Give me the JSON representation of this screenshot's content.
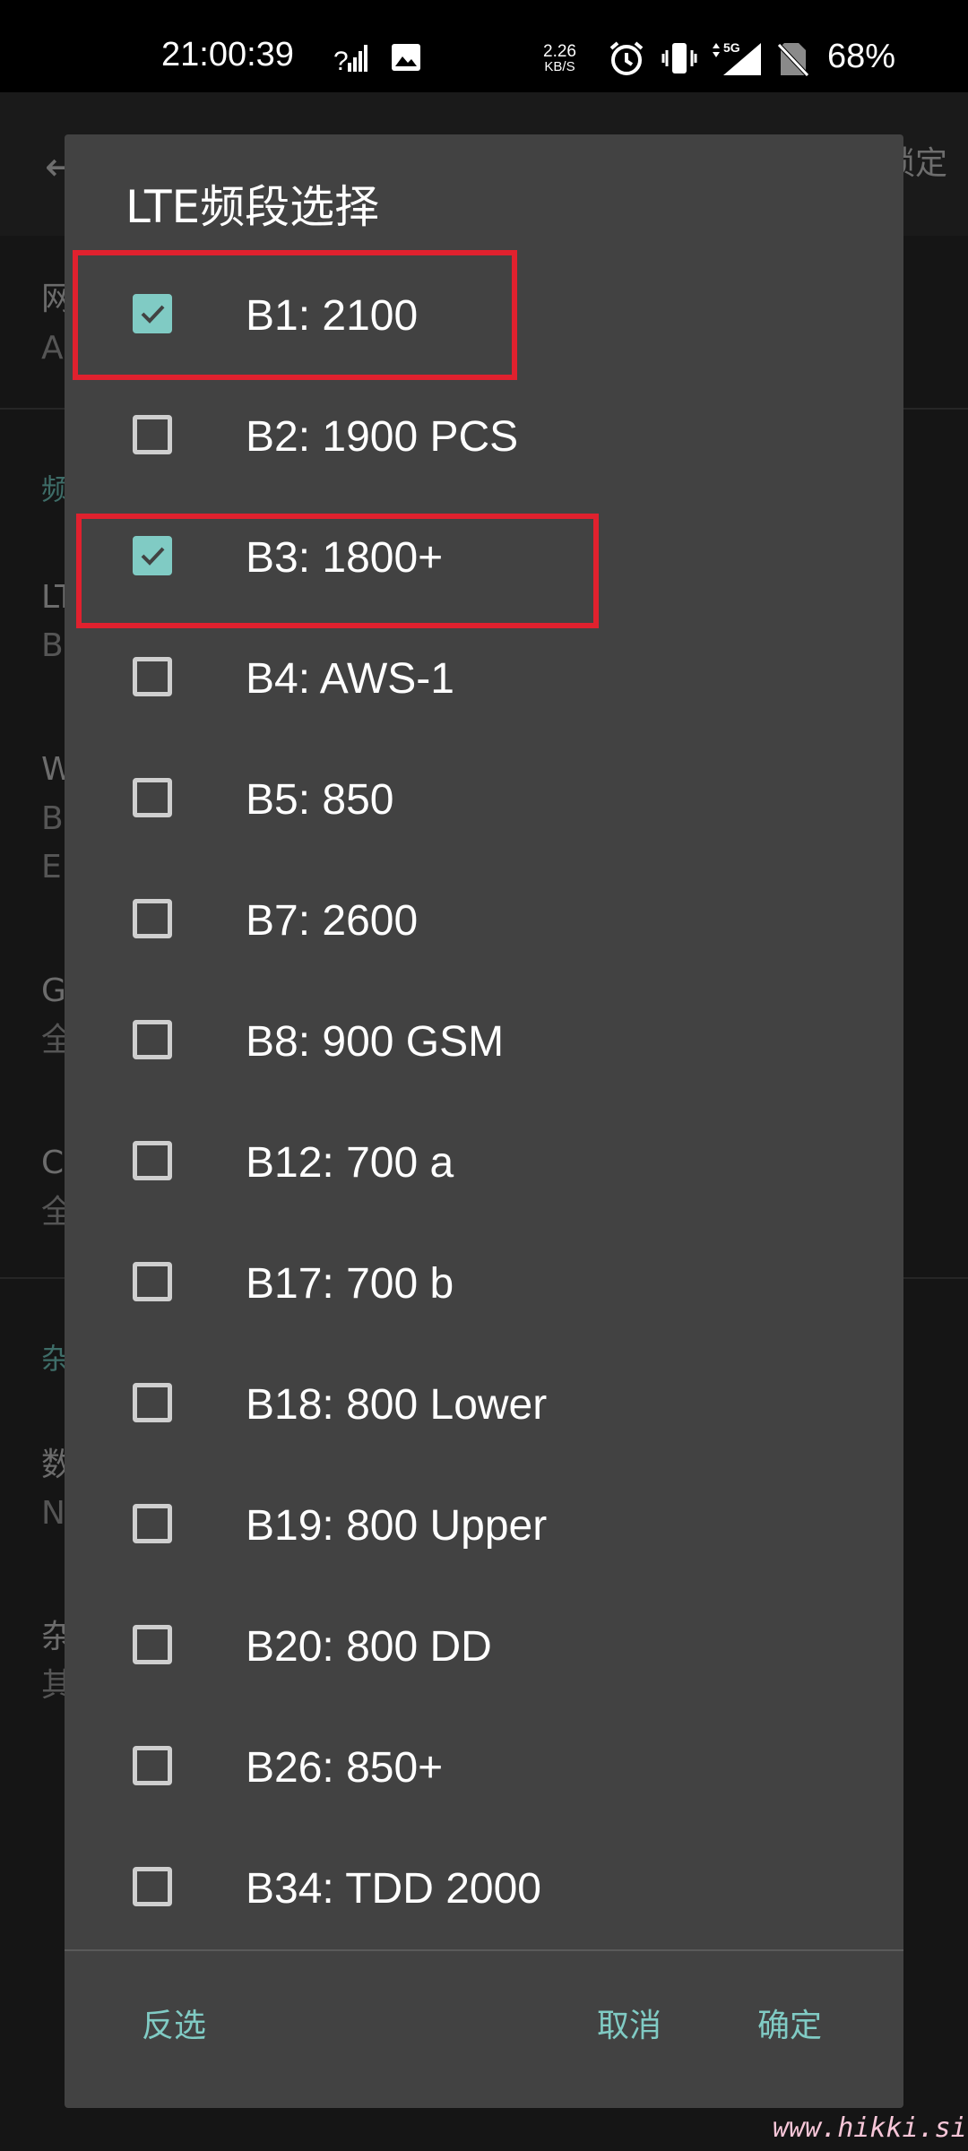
{
  "status_bar": {
    "time": "21:00:39",
    "net_speed_value": "2.26",
    "net_speed_unit": "KB/S",
    "network_type": "5G",
    "battery": "68%",
    "icons": [
      "signal-question-icon",
      "image-icon",
      "alarm-icon",
      "vibrate-icon",
      "mobile-signal-icon",
      "no-sim-icon"
    ]
  },
  "background": {
    "confirm_label": "锁定",
    "rows": [
      {
        "title": "网",
        "subtitle": "A"
      },
      {
        "section": "频"
      },
      {
        "title": "LT",
        "subtitle": "B"
      },
      {
        "title": "W",
        "subtitle": "B",
        "subtitle2": "E"
      },
      {
        "title": "G",
        "subtitle": "全"
      },
      {
        "title": "C",
        "subtitle": "全"
      },
      {
        "section": "杂"
      },
      {
        "title": "数",
        "subtitle": "N"
      },
      {
        "title": "杂",
        "subtitle": "其"
      }
    ]
  },
  "dialog": {
    "title": "LTE频段选择",
    "bands": [
      {
        "label": "B1: 2100",
        "checked": true
      },
      {
        "label": "B2: 1900 PCS",
        "checked": false
      },
      {
        "label": "B3: 1800+",
        "checked": true
      },
      {
        "label": "B4: AWS-1",
        "checked": false
      },
      {
        "label": "B5: 850",
        "checked": false
      },
      {
        "label": "B7: 2600",
        "checked": false
      },
      {
        "label": "B8: 900 GSM",
        "checked": false
      },
      {
        "label": "B12: 700 a",
        "checked": false
      },
      {
        "label": "B17: 700 b",
        "checked": false
      },
      {
        "label": "B18: 800 Lower",
        "checked": false
      },
      {
        "label": "B19: 800 Upper",
        "checked": false
      },
      {
        "label": "B20: 800 DD",
        "checked": false
      },
      {
        "label": "B26: 850+",
        "checked": false
      },
      {
        "label": "B34: TDD 2000",
        "checked": false
      }
    ],
    "buttons": {
      "invert": "反选",
      "cancel": "取消",
      "ok": "确定"
    }
  },
  "colors": {
    "accent": "#80cbc4",
    "dialog_bg": "#424242",
    "highlight": "#e0212e"
  },
  "watermark": "www.hikki.site"
}
